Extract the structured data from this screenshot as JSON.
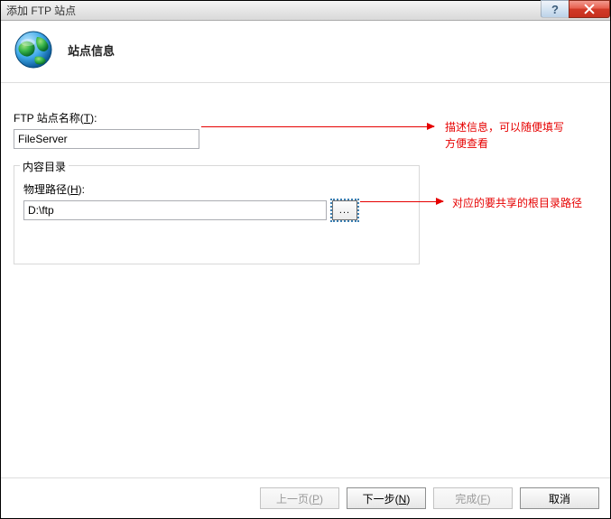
{
  "window": {
    "title": "添加 FTP 站点",
    "help_label": "?",
    "close_label": "×"
  },
  "header": {
    "page_title": "站点信息"
  },
  "form": {
    "site_name_label_prefix": "FTP 站点名称(",
    "site_name_accel": "T",
    "site_name_label_suffix": "):",
    "site_name_value": "FileServer",
    "fieldset_legend": "内容目录",
    "phys_path_label_prefix": "物理路径(",
    "phys_path_accel": "H",
    "phys_path_label_suffix": "):",
    "phys_path_value": "D:\\ftp",
    "browse_label": "..."
  },
  "annotations": {
    "anno1_line1": "描述信息，可以随便填写",
    "anno1_line2": "方便查看",
    "anno2": "对应的要共享的根目录路径"
  },
  "footer": {
    "prev_prefix": "上一页(",
    "prev_accel": "P",
    "prev_suffix": ")",
    "next_prefix": "下一步(",
    "next_accel": "N",
    "next_suffix": ")",
    "finish_prefix": "完成(",
    "finish_accel": "F",
    "finish_suffix": ")",
    "cancel": "取消"
  }
}
